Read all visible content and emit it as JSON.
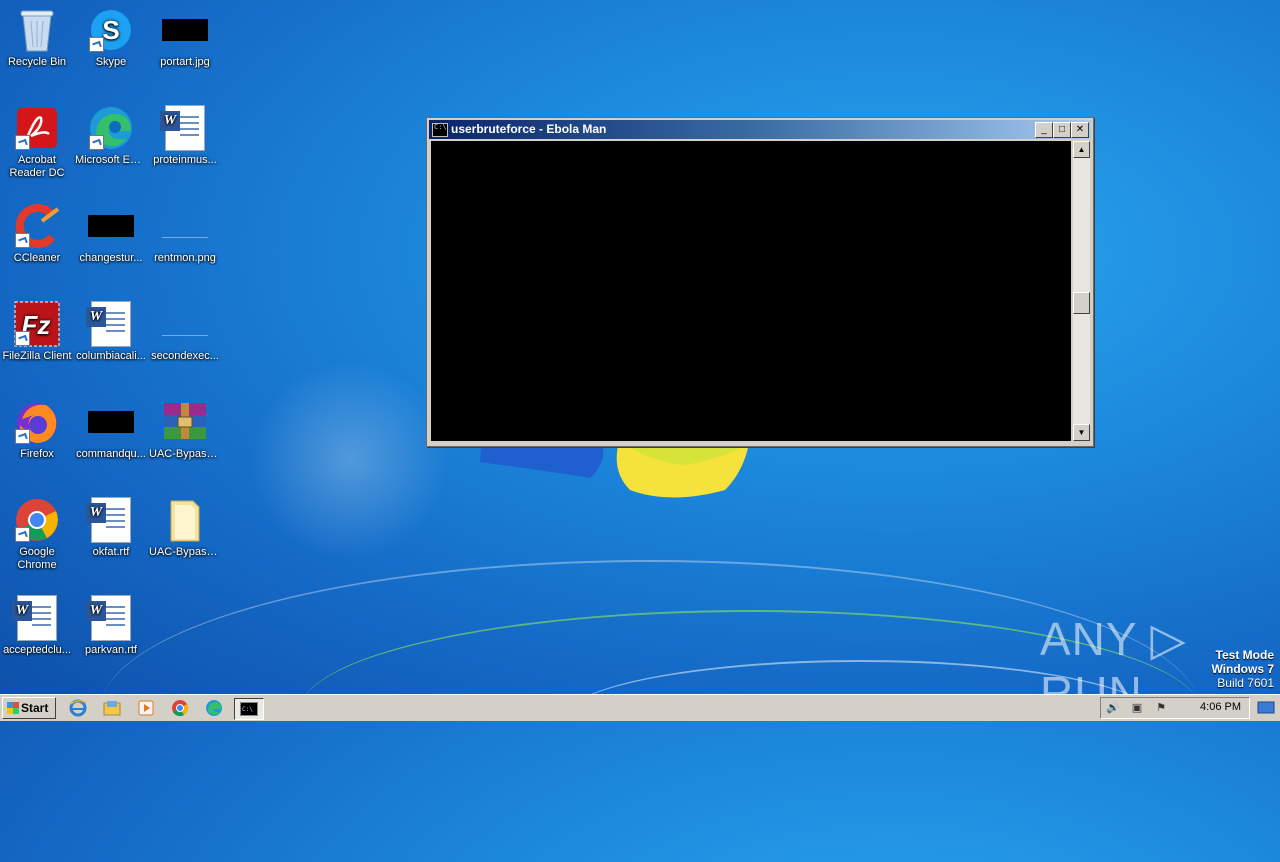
{
  "desktop": {
    "icons": [
      {
        "label": "Recycle Bin",
        "icon": "recycle-bin-icon"
      },
      {
        "label": "Skype",
        "icon": "skype-icon"
      },
      {
        "label": "portart.jpg",
        "icon": "image-file-icon"
      },
      {
        "label": "Acrobat Reader DC",
        "icon": "acrobat-icon"
      },
      {
        "label": "Microsoft Edge",
        "icon": "edge-icon"
      },
      {
        "label": "proteinmus...",
        "icon": "word-document-icon"
      },
      {
        "label": "CCleaner",
        "icon": "ccleaner-icon"
      },
      {
        "label": "changestur...",
        "icon": "file-icon"
      },
      {
        "label": "rentmon.png",
        "icon": "image-file-icon"
      },
      {
        "label": "FileZilla Client",
        "icon": "filezilla-icon"
      },
      {
        "label": "columbiacali...",
        "icon": "word-document-icon"
      },
      {
        "label": "secondexec...",
        "icon": "file-icon"
      },
      {
        "label": "Firefox",
        "icon": "firefox-icon"
      },
      {
        "label": "commandqu...",
        "icon": "file-icon"
      },
      {
        "label": "UAC-Bypass...",
        "icon": "winrar-icon"
      },
      {
        "label": "Google Chrome",
        "icon": "chrome-icon"
      },
      {
        "label": "okfat.rtf",
        "icon": "word-document-icon"
      },
      {
        "label": "UAC-Bypass...",
        "icon": "folder-icon"
      },
      {
        "label": "acceptedclu...",
        "icon": "word-document-icon"
      },
      {
        "label": "parkvan.rtf",
        "icon": "word-document-icon"
      }
    ]
  },
  "window": {
    "title": "userbruteforce - Ebola Man",
    "minimize_glyph": "_",
    "maximize_glyph": "□",
    "close_glyph": "✕"
  },
  "watermark": {
    "brand": "ANY ▷ RUN",
    "line1": "Test Mode",
    "line2": "Windows 7",
    "line3": "Build 7601"
  },
  "taskbar": {
    "start_label": "Start",
    "quick_launch": [
      "internet-explorer-icon",
      "explorer-icon",
      "media-player-icon",
      "chrome-icon",
      "edge-icon"
    ],
    "active_task": "command-prompt-icon",
    "clock": "4:06 PM"
  }
}
